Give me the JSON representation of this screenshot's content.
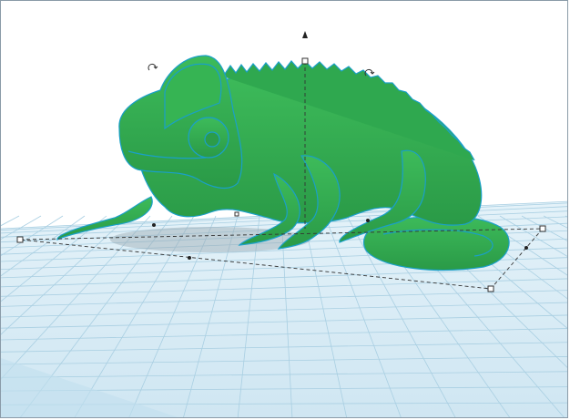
{
  "app": {
    "view": "3d-workplane"
  },
  "workplane": {
    "grid_color": "#9cc7dc",
    "plane_color": "#dbeef7"
  },
  "model": {
    "name": "",
    "body_color": "#2fa84f",
    "outline_color": "#1aa0c8"
  },
  "selection": {
    "box_color": "#333333"
  },
  "icons": {
    "rotate_left": "rotate-handle-icon",
    "rotate_right": "rotate-handle-icon",
    "lift_arrow": "lift-arrow-icon"
  }
}
